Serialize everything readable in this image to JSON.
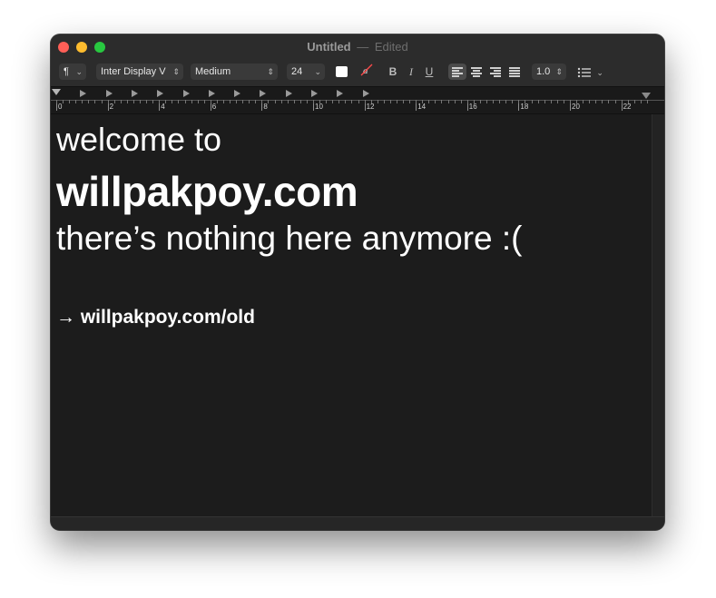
{
  "window": {
    "title": "Untitled",
    "separator": "—",
    "status": "Edited"
  },
  "toolbar": {
    "paragraph_style": "¶",
    "font_family": "Inter Display V",
    "font_weight": "Medium",
    "font_size": "24",
    "text_color": "#ffffff",
    "bold_label": "B",
    "italic_label": "I",
    "underline_label": "U",
    "line_spacing": "1.0",
    "list_icon": "list-icon"
  },
  "ruler": {
    "labels": [
      "0",
      "2",
      "4",
      "6",
      "8",
      "10",
      "12",
      "14",
      "16",
      "18",
      "20",
      "22"
    ]
  },
  "document": {
    "line1": "welcome to",
    "line2": "willpakpoy.com",
    "line3": "there’s nothing here anymore :(",
    "line4": "→ willpakpoy.com/old"
  }
}
